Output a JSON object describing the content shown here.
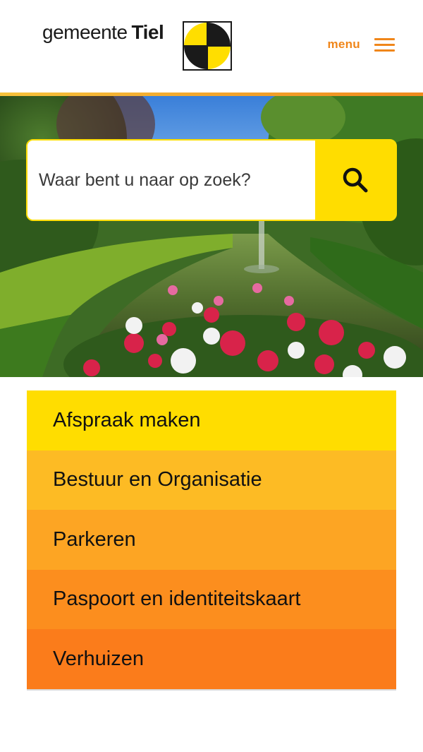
{
  "header": {
    "logo_prefix": "gemeente",
    "logo_name": "Tiel",
    "menu_label": "menu",
    "accent_color": "#f0861a"
  },
  "search": {
    "placeholder": "Waar bent u naar op zoek?",
    "icon": "search-icon",
    "button_color": "#ffdd00"
  },
  "quick_links": [
    {
      "label": "Afspraak maken",
      "color": "#ffdd00"
    },
    {
      "label": "Bestuur en Organisatie",
      "color": "#fdbb24"
    },
    {
      "label": "Parkeren",
      "color": "#fda523"
    },
    {
      "label": "Paspoort en identiteitskaart",
      "color": "#fc8e1e"
    },
    {
      "label": "Verhuizen",
      "color": "#fb7c1b"
    }
  ]
}
